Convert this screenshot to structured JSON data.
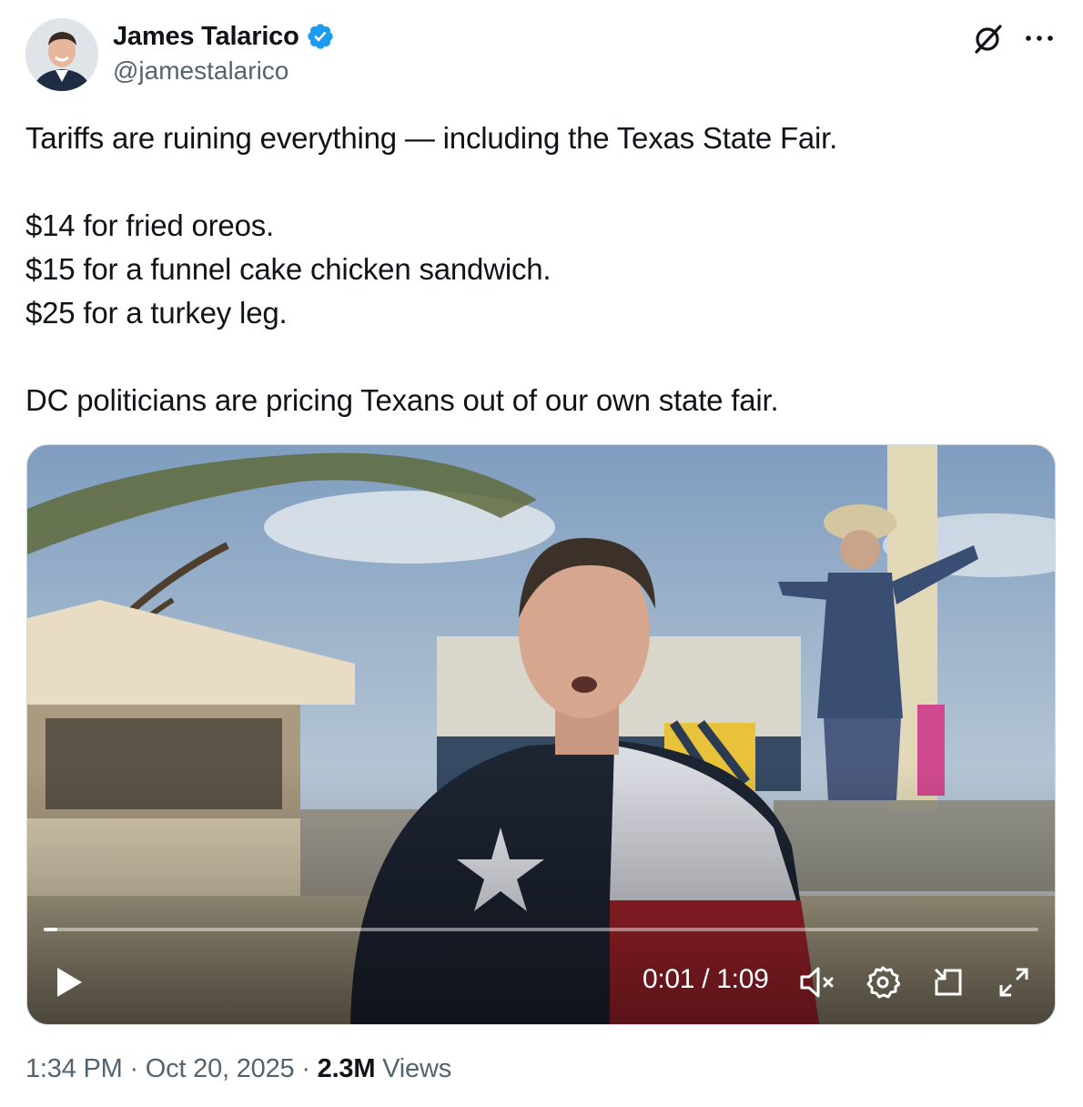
{
  "author": {
    "name": "James Talarico",
    "handle": "@jamestalarico",
    "verified": true,
    "verified_color": "#1d9bf0"
  },
  "tweet": {
    "lines": [
      "Tariffs are ruining everything — including the Texas State Fair.",
      "",
      "$14 for fried oreos.",
      "$15 for a funnel cake chicken sandwich.",
      "$25 for a turkey leg.",
      "",
      "DC politicians are pricing Texans out of our own state fair."
    ]
  },
  "video": {
    "current_time": "0:01",
    "duration": "1:09",
    "time_display": "0:01 / 1:09",
    "progress_fraction": 0.014,
    "muted": true,
    "controls": [
      "play-icon",
      "mute-icon",
      "settings-icon",
      "pip-icon",
      "fullscreen-icon"
    ]
  },
  "meta": {
    "time": "1:34 PM",
    "date": "Oct 20, 2025",
    "separator": "·",
    "views_count": "2.3M",
    "views_label": "Views"
  },
  "colors": {
    "text_primary": "#0f1419",
    "text_secondary": "#536471",
    "border": "#cfd9de"
  }
}
